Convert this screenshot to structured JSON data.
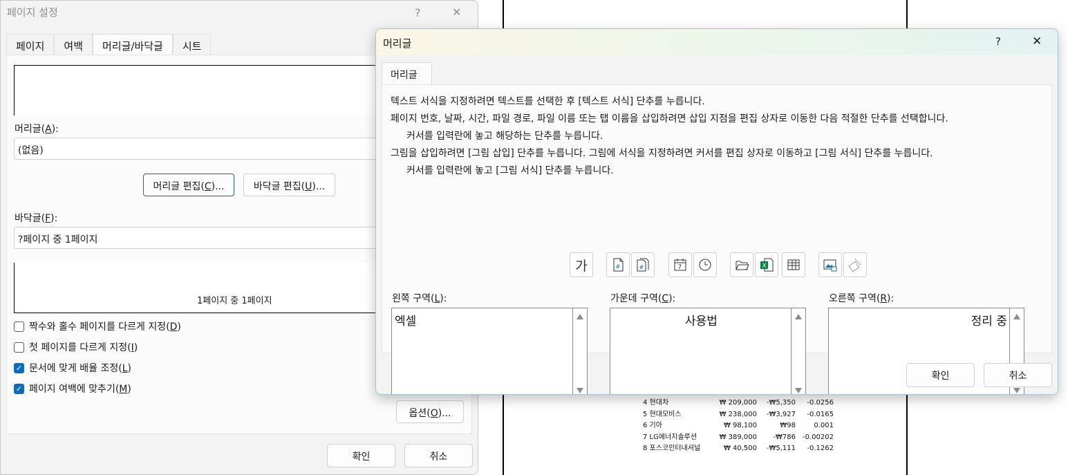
{
  "worksheet": {
    "rows": [
      {
        "name": "4 현대차",
        "price": "₩ 209,000",
        "change": "-₩5,350",
        "rate": "-0.0256"
      },
      {
        "name": "5 현대모비스",
        "price": "₩ 238,000",
        "change": "-₩3,927",
        "rate": "-0.0165"
      },
      {
        "name": "6 기아",
        "price": "₩ 98,100",
        "change": "₩98",
        "rate": "0.001"
      },
      {
        "name": "7 LG에너지솔루션",
        "price": "₩ 389,000",
        "change": "-₩786",
        "rate": "-0.00202"
      },
      {
        "name": "8 포스코인터내셔널",
        "price": "₩ 40,500",
        "change": "-₩5,111",
        "rate": "-0.1262"
      }
    ]
  },
  "page_setup": {
    "title": "페이지 설정",
    "help": "?",
    "close": "✕",
    "tabs": [
      {
        "label": "페이지"
      },
      {
        "label": "여백"
      },
      {
        "label": "머리글/바닥글"
      },
      {
        "label": "시트"
      }
    ],
    "header_label_pre": "머리글(",
    "header_label_key": "A",
    "header_label_post": "):",
    "header_value": "(없음)",
    "edit_header_pre": "머리글 편집(",
    "edit_header_key": "C",
    "edit_header_post": ")...",
    "edit_footer_pre": "바닥글 편집(",
    "edit_footer_key": "U",
    "edit_footer_post": ")...",
    "footer_label_pre": "바닥글(",
    "footer_label_key": "F",
    "footer_label_post": "):",
    "footer_value": "?페이지 중 1페이지",
    "footer_preview_text": "1페이지 중 1페이지",
    "checkboxes": [
      {
        "pre": "짝수와 홀수 페이지를 다르게 지정(",
        "key": "D",
        "post": ")",
        "checked": false
      },
      {
        "pre": "첫 페이지를 다르게 지정(",
        "key": "I",
        "post": ")",
        "checked": false
      },
      {
        "pre": "문서에 맞게 배율 조정(",
        "key": "L",
        "post": ")",
        "checked": true
      },
      {
        "pre": "페이지 여백에 맞추기(",
        "key": "M",
        "post": ")",
        "checked": true
      }
    ],
    "options_pre": "옵션(",
    "options_key": "O",
    "options_post": ")...",
    "ok": "확인",
    "cancel": "취소"
  },
  "header_dialog": {
    "title": "머리글",
    "help": "?",
    "close": "✕",
    "tab": "머리글",
    "instructions": {
      "line1": "텍스트 서식을 지정하려면 텍스트를 선택한 후 [텍스트 서식] 단추를 누릅니다.",
      "line2": "페이지 번호, 날짜, 시간, 파일 경로, 파일 이름 또는 탭 이름을 삽입하려면 삽입 지점을 편집 상자로 이동한 다음 적절한 단추를 선택합니다.",
      "line3": "커서를 입력란에 놓고 해당하는 단추를 누릅니다.",
      "line4": "그림을 삽입하려면 [그림 삽입] 단추를 누릅니다.  그림에 서식을 지정하려면 커서를 편집 상자로 이동하고 [그림 서식] 단추를 누릅니다.",
      "line5": "커서를 입력란에 놓고 [그림 서식] 단추를 누릅니다."
    },
    "format_text_glyph": "가",
    "left_label_pre": "왼쪽 구역(",
    "left_label_key": "L",
    "left_label_post": "):",
    "left_value": "엑셀",
    "center_label_pre": "가운데 구역(",
    "center_label_key": "C",
    "center_label_post": "):",
    "center_value": "사용법",
    "right_label_pre": "오른쪽 구역(",
    "right_label_key": "R",
    "right_label_post": "):",
    "right_value": "정리 중",
    "ok": "확인",
    "cancel": "취소"
  }
}
